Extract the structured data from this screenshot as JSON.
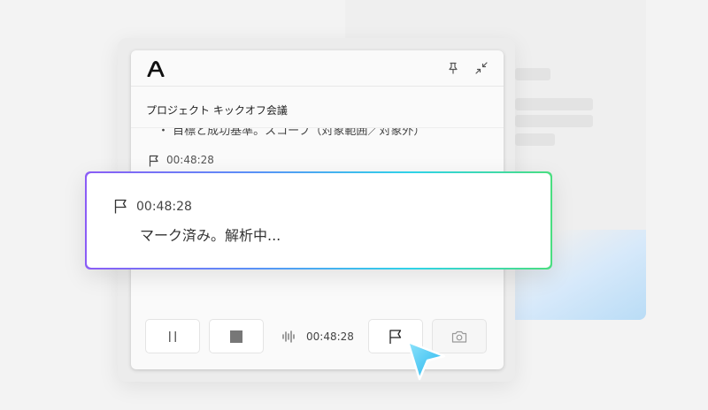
{
  "background": {
    "placeholder_bars": 5
  },
  "widget": {
    "logo_icon": "app-logo-icon",
    "pin_icon": "pin-icon",
    "collapse_icon": "collapse-icon",
    "meeting_title": "プロジェクト キックオフ会議",
    "partial_line": "・ 目標と成功基準。スコープ（対象範囲／対象外）",
    "previous_mark_time": "00:48:28",
    "controls": {
      "pause_icon": "pause-icon",
      "stop_icon": "stop-icon",
      "waveform_icon": "waveform-icon",
      "elapsed_time": "00:48:28",
      "flag_icon": "flag-icon",
      "camera_icon": "camera-icon"
    }
  },
  "popup": {
    "mark_time": "00:48:28",
    "status_text": "マーク済み。解析中..."
  },
  "colors": {
    "gradient_start": "#8b5cf6",
    "gradient_mid": "#2fd3e8",
    "gradient_end": "#4ade80",
    "cursor": "#38c4f0"
  }
}
